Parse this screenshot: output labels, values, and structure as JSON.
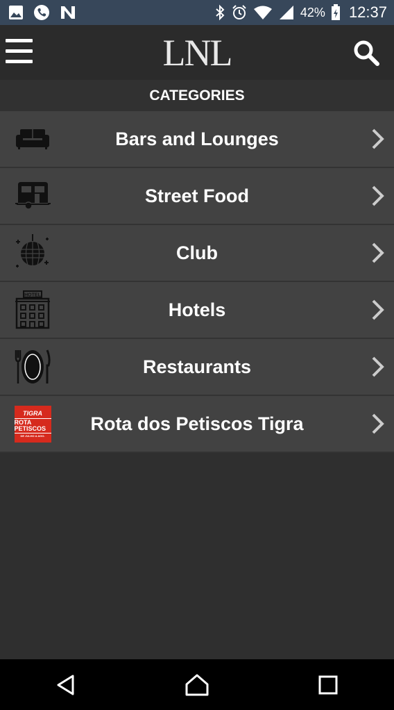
{
  "status_bar": {
    "icons_left": [
      "image-icon",
      "phone-icon",
      "n-icon"
    ],
    "icons_right": [
      "bluetooth-icon",
      "alarm-icon",
      "wifi-icon",
      "signal-icon",
      "battery-icon"
    ],
    "battery_percent": "42%",
    "time": "12:37"
  },
  "app_bar": {
    "logo": "LNL",
    "menu_icon": "hamburger-menu-icon",
    "search_icon": "search-icon"
  },
  "section": {
    "title": "CATEGORIES"
  },
  "categories": [
    {
      "label": "Bars and Lounges",
      "icon": "sofa-icon"
    },
    {
      "label": "Street Food",
      "icon": "food-trailer-icon"
    },
    {
      "label": "Club",
      "icon": "disco-ball-icon"
    },
    {
      "label": "Hotels",
      "icon": "hotel-icon"
    },
    {
      "label": "Restaurants",
      "icon": "plate-cutlery-icon"
    },
    {
      "label": "Rota dos Petiscos Tigra",
      "icon": "rota-badge-logo",
      "badge_text": [
        "TIGRA",
        "ROTA PETISCOS",
        "DE JULHO A AGO."
      ]
    }
  ],
  "nav_bar": {
    "buttons": [
      "back-icon",
      "home-icon",
      "recent-apps-icon"
    ]
  },
  "colors": {
    "status_bar": "#37475a",
    "app_bar": "#2b2b2b",
    "row": "#424242",
    "background": "#2f2f2f",
    "badge": "#d62a1d"
  }
}
